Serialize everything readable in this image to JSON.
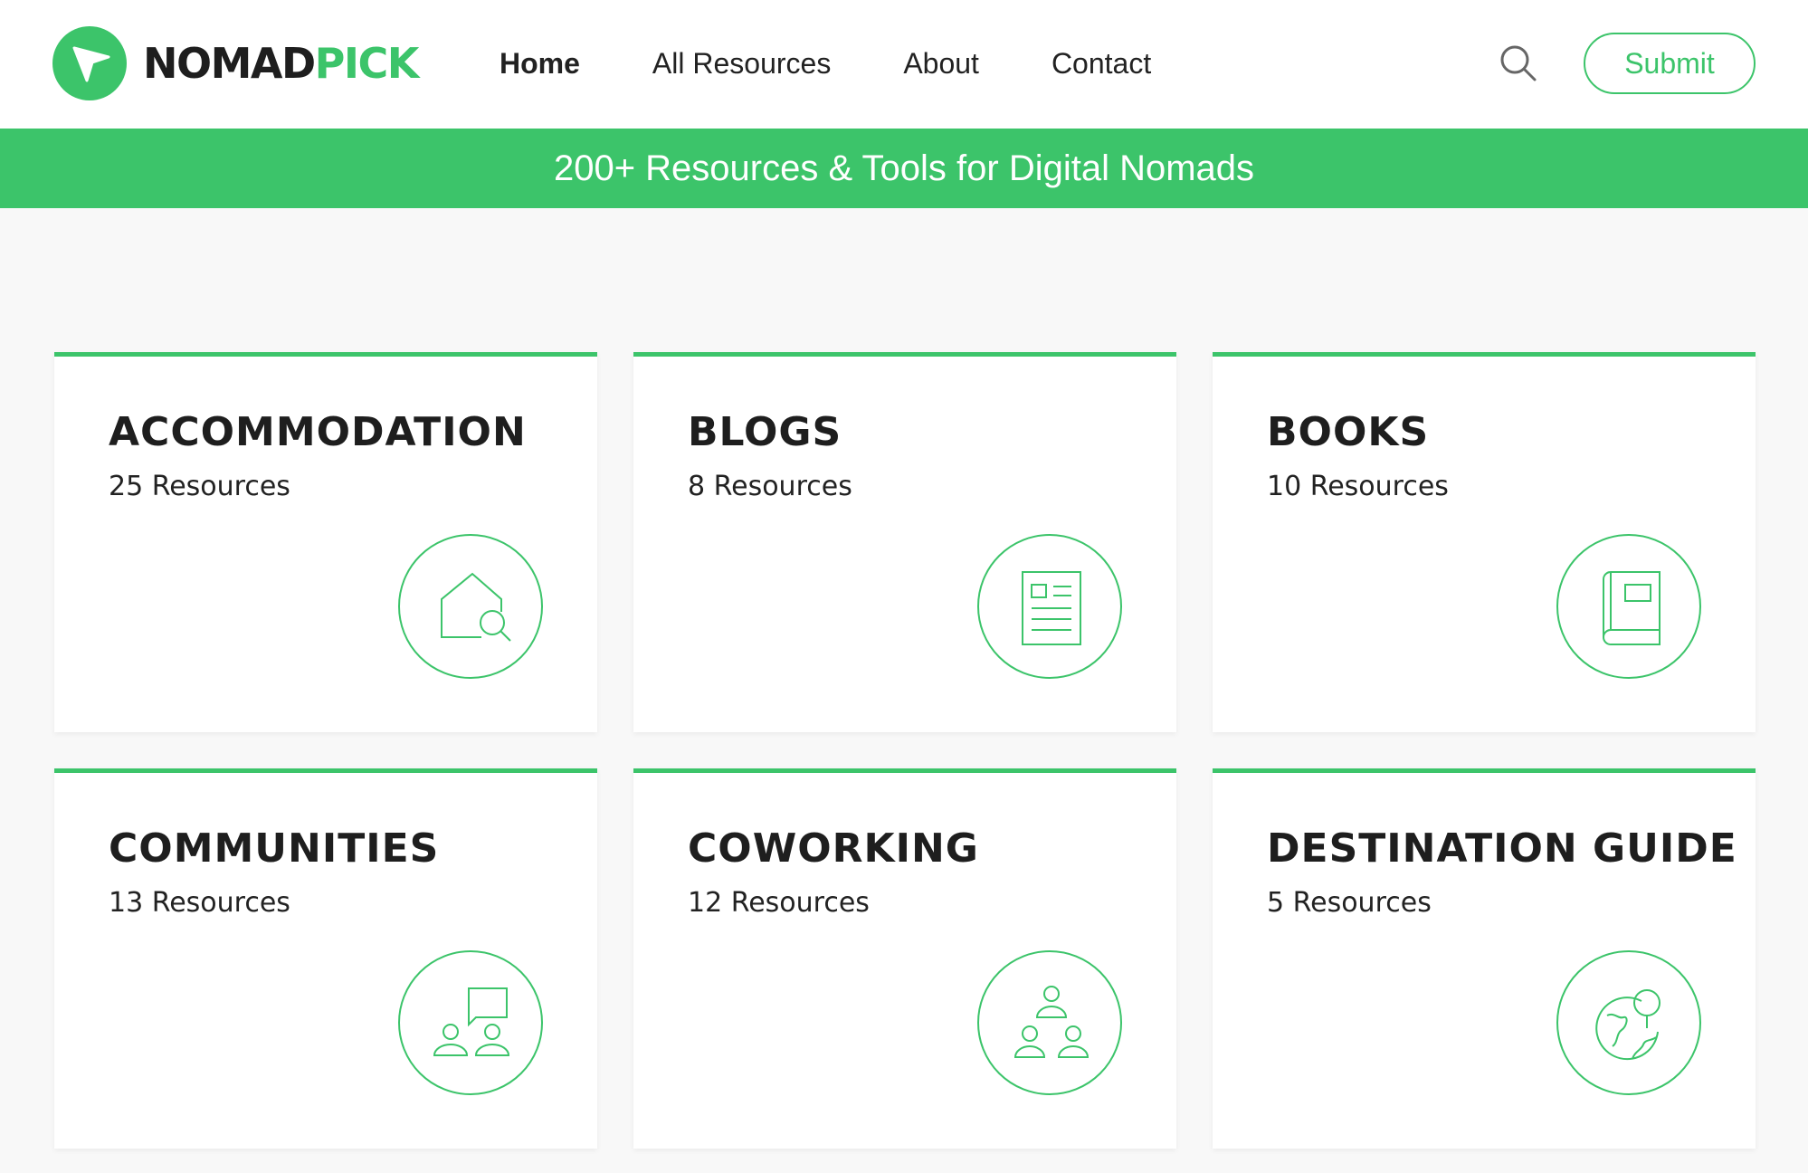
{
  "header": {
    "logo_word1": "NOMAD",
    "logo_word2": "PICK",
    "nav": [
      {
        "label": "Home",
        "active": true
      },
      {
        "label": "All Resources",
        "active": false
      },
      {
        "label": "About",
        "active": false
      },
      {
        "label": "Contact",
        "active": false
      }
    ],
    "search_icon": "search-icon",
    "submit_label": "Submit"
  },
  "banner": {
    "text": "200+ Resources & Tools for Digital Nomads"
  },
  "colors": {
    "accent": "#3cc46a",
    "text_dark": "#1e1e1e",
    "background": "#f8f8f8"
  },
  "categories": [
    {
      "title": "ACCOMMODATION",
      "count": "25 Resources",
      "icon": "house-search-icon"
    },
    {
      "title": "BLOGS",
      "count": "8 Resources",
      "icon": "article-icon"
    },
    {
      "title": "BOOKS",
      "count": "10 Resources",
      "icon": "book-icon"
    },
    {
      "title": "COMMUNITIES",
      "count": "13 Resources",
      "icon": "community-chat-icon"
    },
    {
      "title": "COWORKING",
      "count": "12 Resources",
      "icon": "team-icon"
    },
    {
      "title": "DESTINATION GUIDE",
      "count": "5 Resources",
      "icon": "globe-pin-icon"
    }
  ]
}
